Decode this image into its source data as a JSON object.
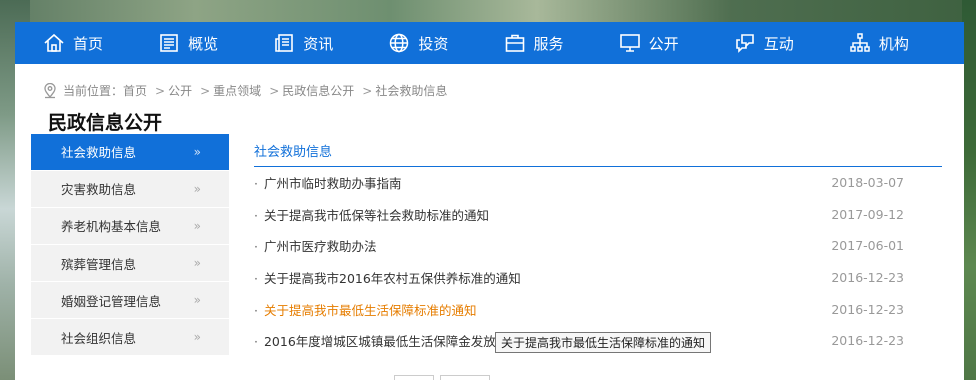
{
  "nav": [
    {
      "label": "首页",
      "icon": "home-icon"
    },
    {
      "label": "概览",
      "icon": "overview-icon"
    },
    {
      "label": "资讯",
      "icon": "news-icon"
    },
    {
      "label": "投资",
      "icon": "globe-icon"
    },
    {
      "label": "服务",
      "icon": "briefcase-icon"
    },
    {
      "label": "公开",
      "icon": "monitor-icon"
    },
    {
      "label": "互动",
      "icon": "chat-icon"
    },
    {
      "label": "机构",
      "icon": "org-chart-icon"
    }
  ],
  "breadcrumb": {
    "prefix": "当前位置：",
    "items": [
      "首页",
      "公开",
      "重点领域",
      "民政信息公开",
      "社会救助信息"
    ],
    "separator": ">"
  },
  "section_title": "民政信息公开",
  "sidebar": {
    "items": [
      {
        "label": "社会救助信息",
        "active": true
      },
      {
        "label": "灾害救助信息",
        "active": false
      },
      {
        "label": "养老机构基本信息",
        "active": false
      },
      {
        "label": "殡葬管理信息",
        "active": false
      },
      {
        "label": "婚姻登记管理信息",
        "active": false
      },
      {
        "label": "社会组织信息",
        "active": false
      }
    ],
    "chevron": "»"
  },
  "content": {
    "heading": "社会救助信息",
    "rows": [
      {
        "title": "广州市临时救助办事指南",
        "date": "2018-03-07"
      },
      {
        "title": "关于提高我市低保等社会救助标准的通知",
        "date": "2017-09-12"
      },
      {
        "title": "广州市医疗救助办法",
        "date": "2017-06-01"
      },
      {
        "title": "关于提高我市2016年农村五保供养标准的通知",
        "date": "2016-12-23"
      },
      {
        "title": "关于提高我市最低生活保障标准的通知",
        "date": "2016-12-23"
      },
      {
        "title": "2016年度增城区城镇最低生活保障金发放汇",
        "date": "2016-12-23"
      }
    ],
    "tooltip": "关于提高我市最低生活保障标准的通知"
  },
  "colors": {
    "accent": "#1170d9",
    "hover": "#e67d00"
  }
}
